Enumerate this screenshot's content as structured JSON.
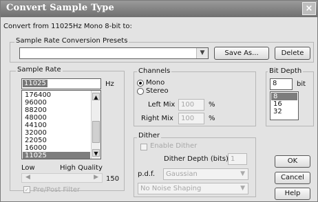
{
  "window": {
    "title": "Convert Sample Type",
    "close": "×"
  },
  "heading": "Convert from 11025Hz Mono 8-bit to:",
  "presets": {
    "label": "Sample Rate Conversion Presets",
    "value": "",
    "save": "Save As...",
    "delete": "Delete"
  },
  "sample_rate": {
    "label": "Sample Rate",
    "value": "11025",
    "unit": "Hz",
    "options": [
      "176400",
      "96000",
      "88200",
      "48000",
      "44100",
      "32000",
      "22050",
      "16000",
      "11025"
    ],
    "selected": "11025",
    "low": "Low",
    "high": "High Quality",
    "quality": "150",
    "prepost": "Pre/Post Filter"
  },
  "channels": {
    "label": "Channels",
    "mono": "Mono",
    "stereo": "Stereo",
    "left": "Left Mix",
    "left_val": "100",
    "right": "Right Mix",
    "right_val": "100",
    "pct": "%"
  },
  "bitdepth": {
    "label": "Bit Depth",
    "value": "8",
    "unit": "bit",
    "options": [
      "8",
      "16",
      "32"
    ],
    "selected": "8"
  },
  "dither": {
    "label": "Dither",
    "enable": "Enable Dither",
    "depth_label": "Dither Depth (bits)",
    "depth_val": "1",
    "pdf_label": "p.d.f.",
    "pdf_val": "Gaussian",
    "shaping_val": "No Noise Shaping"
  },
  "buttons": {
    "ok": "OK",
    "cancel": "Cancel",
    "help": "Help"
  }
}
